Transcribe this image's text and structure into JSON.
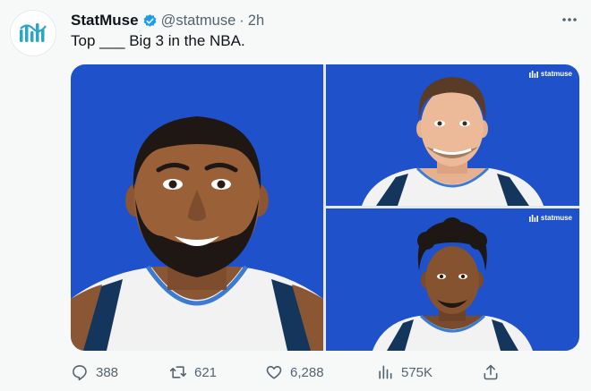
{
  "tweet": {
    "author_name": "StatMuse",
    "handle": "@statmuse",
    "separator": "·",
    "time": "2h",
    "text": "Top ___ Big 3 in the NBA."
  },
  "media": {
    "panels": [
      {
        "name": "left",
        "watermark": ""
      },
      {
        "name": "top-right",
        "watermark": "statmuse"
      },
      {
        "name": "bottom-right",
        "watermark": "statmuse"
      }
    ]
  },
  "actions": {
    "replies": "388",
    "retweets": "621",
    "likes": "6,288",
    "views": "575K"
  },
  "colors": {
    "panel_blue": "#1f51ca",
    "verified": "#1d9bf0",
    "muted_text": "#536471",
    "brand_teal": "#2aa6c6"
  },
  "icons": [
    "statmuse-logo-icon",
    "verified-badge-icon",
    "more-icon",
    "reply-icon",
    "retweet-icon",
    "like-icon",
    "views-icon",
    "share-icon"
  ]
}
